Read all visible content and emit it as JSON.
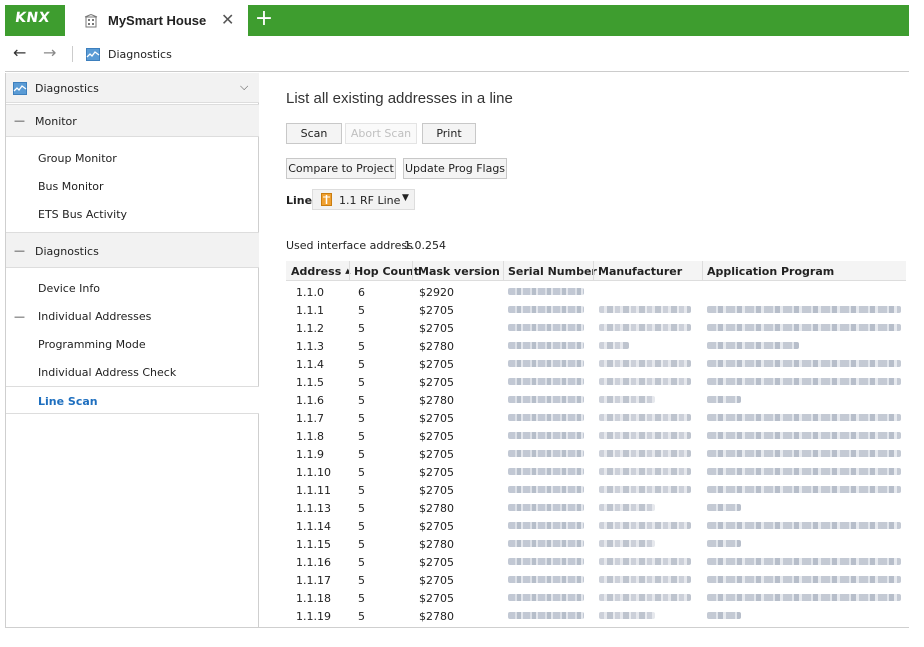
{
  "titlebar": {
    "logo": "KNX",
    "tab_title": "MySmart House",
    "close_glyph": "✕",
    "add_glyph": "+"
  },
  "navbar": {
    "back_glyph": "←",
    "forward_glyph": "→",
    "title": "Diagnostics"
  },
  "sidebar": {
    "header": "Diagnostics",
    "chevron": "⌵",
    "sections": [
      {
        "label": "Monitor",
        "items": [
          "Group Monitor",
          "Bus Monitor",
          "ETS Bus Activity"
        ]
      },
      {
        "label": "Diagnostics",
        "items": [
          "Device Info",
          "Individual Addresses",
          "Programming Mode",
          "Individual Address Check",
          "Line Scan"
        ]
      }
    ],
    "dash": "—",
    "selected": "Line Scan"
  },
  "main": {
    "title": "List all existing addresses in a line",
    "buttons": {
      "scan": "Scan",
      "abort_scan": "Abort Scan",
      "print": "Print",
      "compare": "Compare to Project",
      "update_flags": "Update Prog Flags"
    },
    "line_label": "Line",
    "line_value": "1.1 RF Line",
    "line_arrow": "▼",
    "interface_label": "Used interface address",
    "interface_value": "1.0.254"
  },
  "table": {
    "columns": [
      "Address",
      "Hop Count",
      "Mask version",
      "Serial Number",
      "Manufacturer",
      "Application Program"
    ],
    "sort_indicator": "▲",
    "rows": [
      {
        "address": "1.1.0",
        "hop": "6",
        "mask": "$2920",
        "mfr_blur": 0,
        "app_blur": 0
      },
      {
        "address": "1.1.1",
        "hop": "5",
        "mask": "$2705",
        "mfr_blur": 1,
        "app_blur": 1
      },
      {
        "address": "1.1.2",
        "hop": "5",
        "mask": "$2705",
        "mfr_blur": 1,
        "app_blur": 1
      },
      {
        "address": "1.1.3",
        "hop": "5",
        "mask": "$2780",
        "mfr_blur": 2,
        "app_blur": 2
      },
      {
        "address": "1.1.4",
        "hop": "5",
        "mask": "$2705",
        "mfr_blur": 1,
        "app_blur": 1
      },
      {
        "address": "1.1.5",
        "hop": "5",
        "mask": "$2705",
        "mfr_blur": 1,
        "app_blur": 1
      },
      {
        "address": "1.1.6",
        "hop": "5",
        "mask": "$2780",
        "mfr_blur": 3,
        "app_blur": 3
      },
      {
        "address": "1.1.7",
        "hop": "5",
        "mask": "$2705",
        "mfr_blur": 1,
        "app_blur": 1
      },
      {
        "address": "1.1.8",
        "hop": "5",
        "mask": "$2705",
        "mfr_blur": 1,
        "app_blur": 1
      },
      {
        "address": "1.1.9",
        "hop": "5",
        "mask": "$2705",
        "mfr_blur": 1,
        "app_blur": 1
      },
      {
        "address": "1.1.10",
        "hop": "5",
        "mask": "$2705",
        "mfr_blur": 1,
        "app_blur": 1
      },
      {
        "address": "1.1.11",
        "hop": "5",
        "mask": "$2705",
        "mfr_blur": 1,
        "app_blur": 1
      },
      {
        "address": "1.1.13",
        "hop": "5",
        "mask": "$2780",
        "mfr_blur": 3,
        "app_blur": 3
      },
      {
        "address": "1.1.14",
        "hop": "5",
        "mask": "$2705",
        "mfr_blur": 1,
        "app_blur": 1
      },
      {
        "address": "1.1.15",
        "hop": "5",
        "mask": "$2780",
        "mfr_blur": 3,
        "app_blur": 3
      },
      {
        "address": "1.1.16",
        "hop": "5",
        "mask": "$2705",
        "mfr_blur": 1,
        "app_blur": 1
      },
      {
        "address": "1.1.17",
        "hop": "5",
        "mask": "$2705",
        "mfr_blur": 1,
        "app_blur": 1
      },
      {
        "address": "1.1.18",
        "hop": "5",
        "mask": "$2705",
        "mfr_blur": 1,
        "app_blur": 1
      },
      {
        "address": "1.1.19",
        "hop": "5",
        "mask": "$2780",
        "mfr_blur": 3,
        "app_blur": 3
      }
    ]
  },
  "colors": {
    "brand_green": "#3e9d2f",
    "link_blue": "#1e6fbf"
  }
}
